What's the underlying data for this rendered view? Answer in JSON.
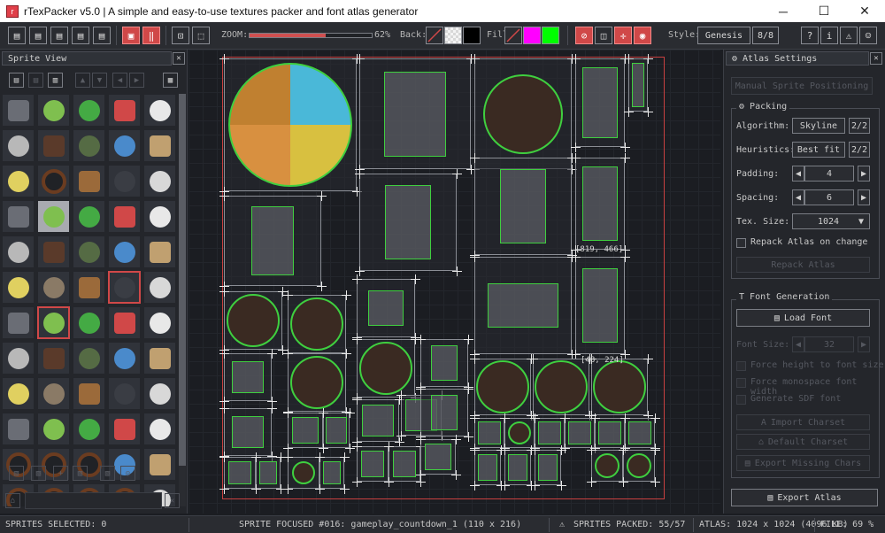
{
  "window": {
    "title": "rTexPacker v5.0 | A simple and easy-to-use textures packer and font atlas generator",
    "minimize": "─",
    "maximize": "☐",
    "close": "✕"
  },
  "toolbar": {
    "zoom_label": "ZOOM:",
    "zoom_percent": "62%",
    "zoom_fraction": 0.62,
    "back_label": "Back:",
    "fill_label": "Fill:",
    "style_label": "Style:",
    "style_value": "Genesis",
    "style_page": "8/8",
    "colors": {
      "back_checker": "#d8d8d8",
      "back_black": "#000000",
      "fill_magenta": "#ff00ff",
      "fill_green": "#00ff00",
      "accent_red": "#d04848"
    }
  },
  "sprite_view": {
    "title": "Sprite View",
    "close": "✕"
  },
  "canvas": {
    "coord_a": "[819, 466]",
    "coord_b": "[48, 224]"
  },
  "atlas_settings": {
    "title": "Atlas Settings",
    "close": "✕",
    "manual_positioning": "Manual Sprite Positioning",
    "packing_label": "Packing",
    "algorithm_label": "Algorithm:",
    "algorithm_value": "Skyline",
    "algorithm_page": "2/2",
    "heuristics_label": "Heuristics:",
    "heuristics_value": "Best fit",
    "heuristics_page": "2/2",
    "padding_label": "Padding:",
    "padding_value": "4",
    "spacing_label": "Spacing:",
    "spacing_value": "6",
    "texsize_label": "Tex. Size:",
    "texsize_value": "1024",
    "repack_on_change": "Repack Atlas on change",
    "repack_button": "Repack Atlas",
    "font_label": "Font Generation",
    "load_font": "Load Font",
    "font_size_label": "Font Size:",
    "font_size_value": "32",
    "force_height": "Force height to font size",
    "force_monospace": "Force monospace font width",
    "generate_sdf": "Generate SDF font",
    "import_charset": "Import Charset",
    "default_charset": "Default Charset",
    "export_missing": "Export Missing Chars",
    "export_atlas": "Export Atlas"
  },
  "status": {
    "selected": "SPRITES SELECTED: 0",
    "focused": "SPRITE FOCUSED #016: gameplay_countdown_1 (110 x 216)",
    "packed": "SPRITES PACKED: 55/57",
    "atlas": "ATLAS: 1024 x 1024 (4096 KB)",
    "fill": "FILL: 69 %"
  }
}
